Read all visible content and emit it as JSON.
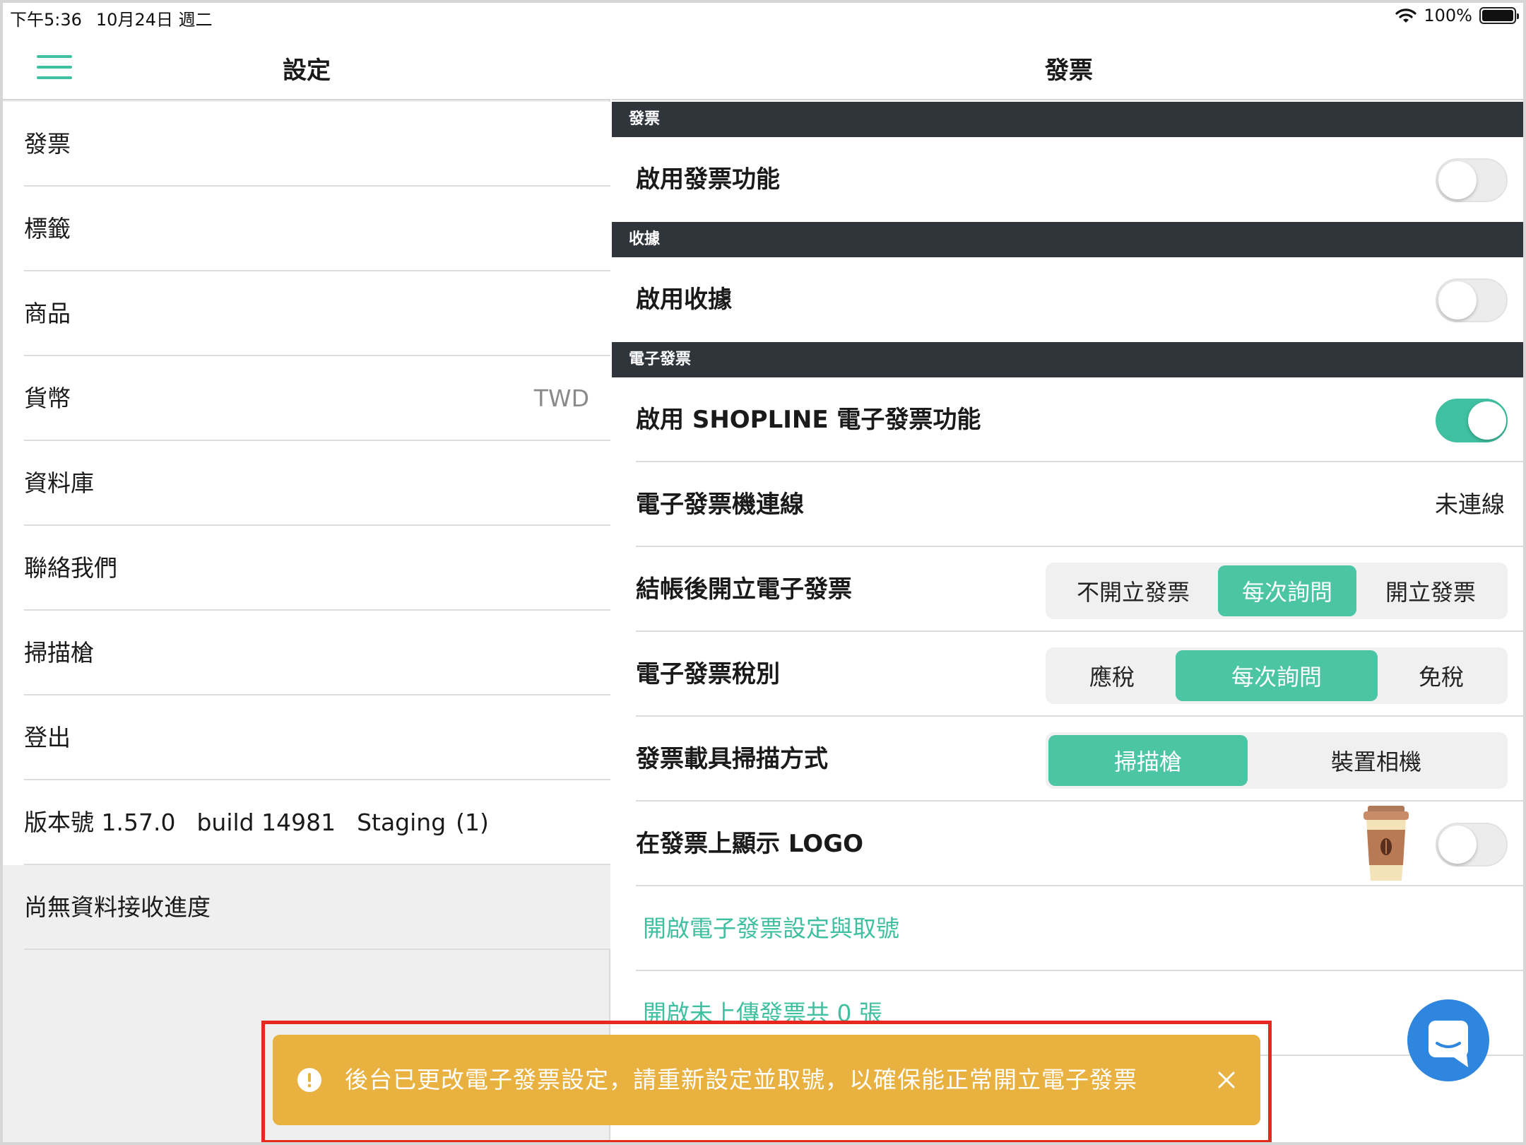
{
  "status_bar": {
    "time": "下午5:36",
    "date": "10月24日 週二",
    "battery": "100%"
  },
  "left": {
    "title": "設定",
    "items": [
      {
        "label": "發票",
        "value": ""
      },
      {
        "label": "標籤",
        "value": ""
      },
      {
        "label": "商品",
        "value": ""
      },
      {
        "label": "貨幣",
        "value": "TWD"
      },
      {
        "label": "資料庫",
        "value": ""
      },
      {
        "label": "聯絡我們",
        "value": ""
      },
      {
        "label": "掃描槍",
        "value": ""
      },
      {
        "label": "登出",
        "value": ""
      }
    ],
    "version": {
      "label": "版本號 1.57.0",
      "build": "build 14981",
      "env": "Staging",
      "count": "(1)"
    },
    "progress_text": "尚無資料接收進度"
  },
  "right": {
    "title": "發票",
    "sections": {
      "invoice": {
        "header": "發票",
        "enable_label": "啟用發票功能",
        "enable_on": false
      },
      "receipt": {
        "header": "收據",
        "enable_label": "啟用收據",
        "enable_on": false
      },
      "einvoice": {
        "header": "電子發票",
        "enable_label": "啟用 SHOPLINE 電子發票功能",
        "enable_on": true,
        "connection_label": "電子發票機連線",
        "connection_value": "未連線",
        "issue_label": "結帳後開立電子發票",
        "issue_options": [
          "不開立發票",
          "每次詢問",
          "開立發票"
        ],
        "issue_selected": "每次詢問",
        "tax_label": "電子發票稅別",
        "tax_options": [
          "應稅",
          "每次詢問",
          "免稅"
        ],
        "tax_selected": "每次詢問",
        "scan_label": "發票載具掃描方式",
        "scan_options": [
          "掃描槍",
          "裝置相機"
        ],
        "scan_selected": "掃描槍",
        "logo_label": "在發票上顯示 LOGO",
        "logo_on": false,
        "link_settings": "開啟電子發票設定與取號",
        "link_unuploaded": "開啟未上傳發票共 0 張"
      }
    }
  },
  "toast": {
    "message": "後台已更改電子發票設定，請重新設定並取號，以確保能正常開立電子發票",
    "color": "#e9b13f"
  },
  "colors": {
    "accent": "#3fc0a0",
    "section_bg": "#2f353b",
    "chat": "#2e86de",
    "highlight_outline": "#e8281e"
  }
}
